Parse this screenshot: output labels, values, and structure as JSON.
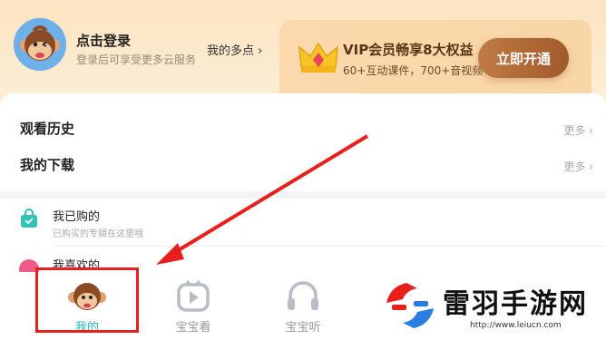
{
  "header": {
    "login_title": "点击登录",
    "login_sub": "登录后可享受更多云服务",
    "more_points": "我的多点 ›"
  },
  "vip": {
    "title": "VIP会员畅享8大权益",
    "sub": "60+互动课件，700+音视频",
    "button": "立即开通"
  },
  "rows": [
    {
      "label": "观看历史",
      "more": "更多 ›"
    },
    {
      "label": "我的下载",
      "more": "更多 ›"
    }
  ],
  "list": [
    {
      "title": "我已购的",
      "sub": "已购买的专辑在这里哦"
    },
    {
      "title": "我喜欢的",
      "sub": ""
    }
  ],
  "tabs": [
    {
      "label": "我的"
    },
    {
      "label": "宝宝看"
    },
    {
      "label": "宝宝听"
    }
  ],
  "watermark": {
    "text": "雷羽手游网",
    "url": "http://www.leiucn.com"
  },
  "colors": {
    "accent": "#22b8c6",
    "vip_button": "#b06a36",
    "highlight": "#e8201c"
  }
}
